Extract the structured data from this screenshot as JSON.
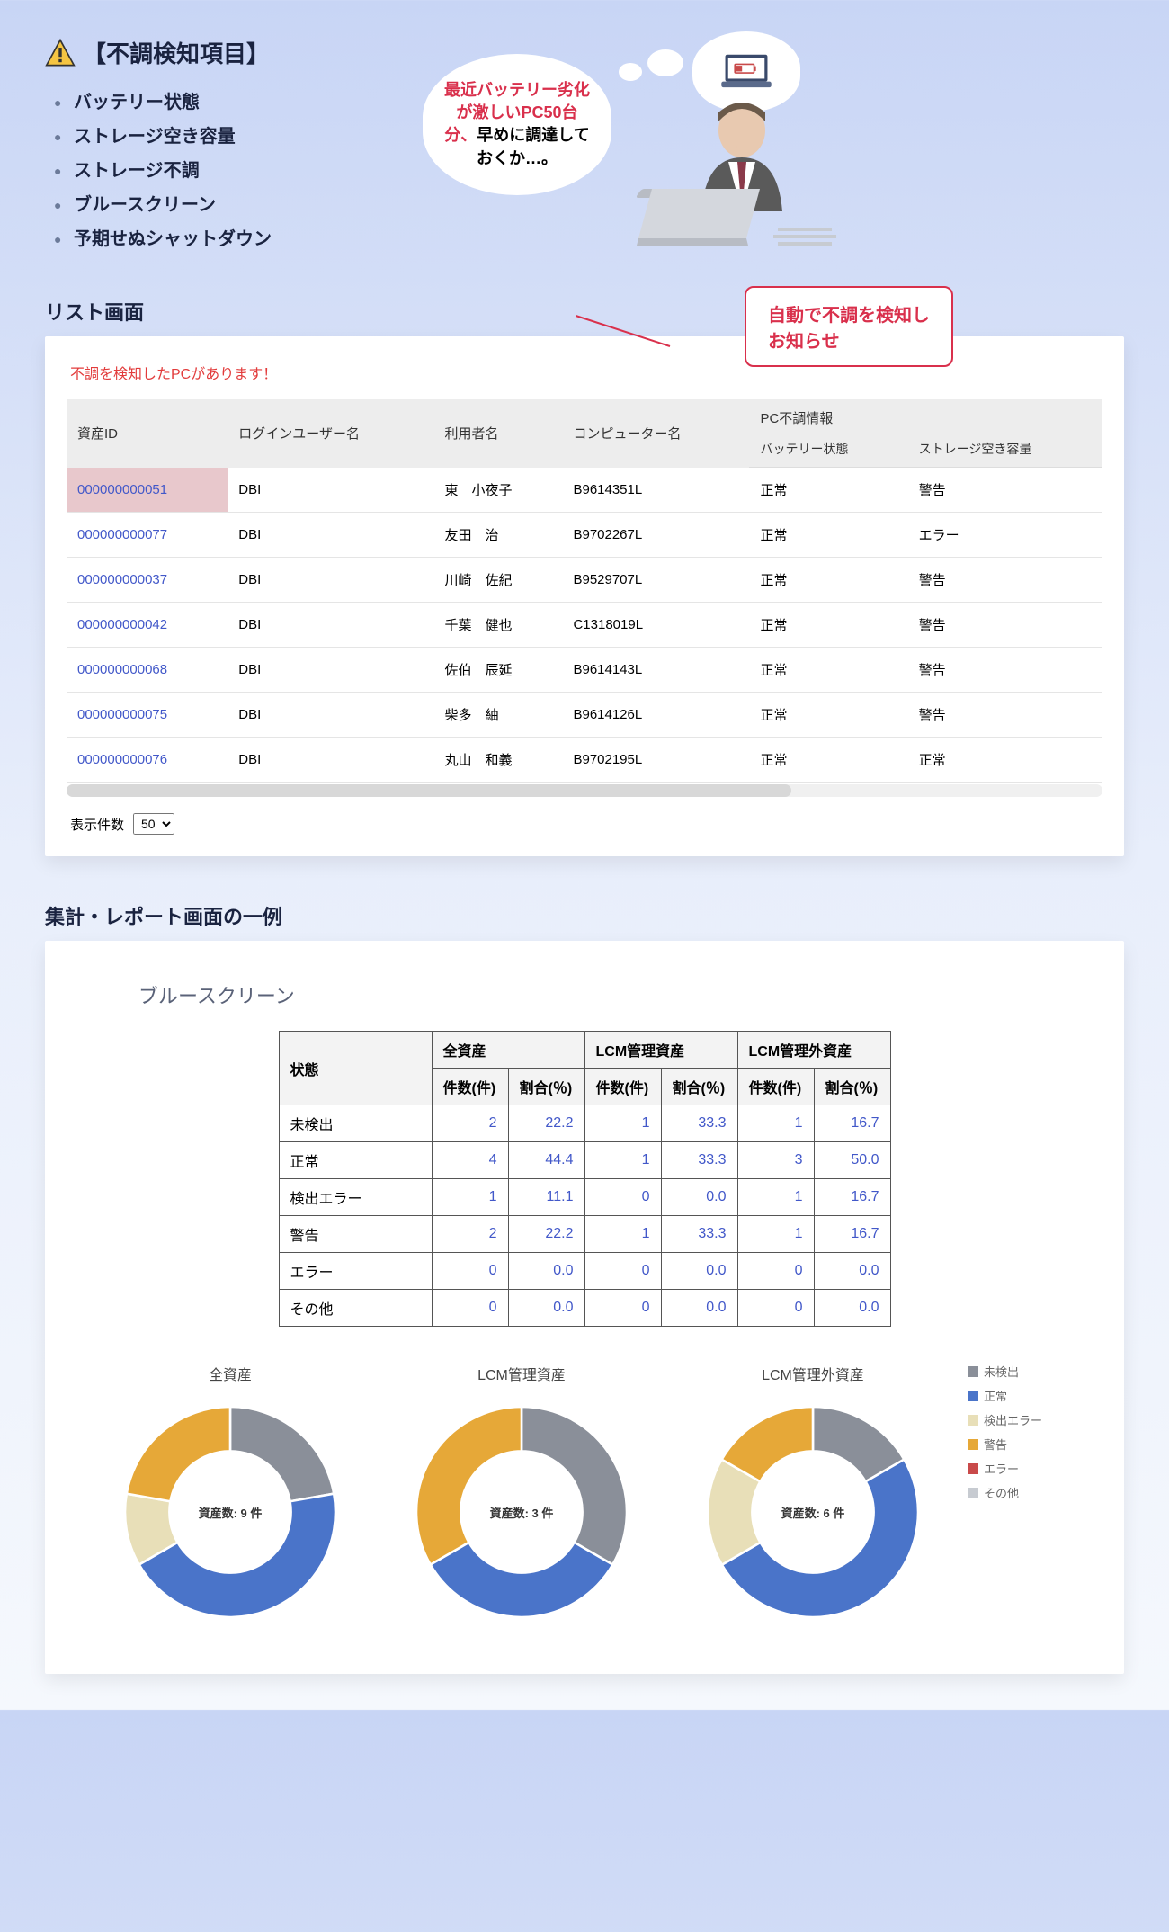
{
  "header": {
    "detection_title": "【不調検知項目】",
    "detection_items": [
      "バッテリー状態",
      "ストレージ空き容量",
      "ストレージ不調",
      "ブルースクリーン",
      "予期せぬシャットダウン"
    ],
    "thought_red": "最近バッテリー劣化が激しいPC50台分、",
    "thought_black": "早めに調達しておくか…。"
  },
  "list_section": {
    "label": "リスト画面",
    "callout": "自動で不調を検知し\nお知らせ",
    "alert": "不調を検知したPCがあります！",
    "columns": {
      "asset_id": "資産ID",
      "login_user": "ログインユーザー名",
      "user_name": "利用者名",
      "computer_name": "コンピューター名",
      "pc_fault_info": "PC不調情報",
      "battery": "バッテリー状態",
      "storage": "ストレージ空き容量"
    },
    "rows": [
      {
        "asset_id": "000000000051",
        "login": "DBI",
        "user": "東　小夜子",
        "computer": "B9614351L",
        "battery": "正常",
        "storage": "警告"
      },
      {
        "asset_id": "000000000077",
        "login": "DBI",
        "user": "友田　治",
        "computer": "B9702267L",
        "battery": "正常",
        "storage": "エラー"
      },
      {
        "asset_id": "000000000037",
        "login": "DBI",
        "user": "川崎　佐紀",
        "computer": "B9529707L",
        "battery": "正常",
        "storage": "警告"
      },
      {
        "asset_id": "000000000042",
        "login": "DBI",
        "user": "千葉　健也",
        "computer": "C1318019L",
        "battery": "正常",
        "storage": "警告"
      },
      {
        "asset_id": "000000000068",
        "login": "DBI",
        "user": "佐伯　辰延",
        "computer": "B9614143L",
        "battery": "正常",
        "storage": "警告"
      },
      {
        "asset_id": "000000000075",
        "login": "DBI",
        "user": "柴多　紬",
        "computer": "B9614126L",
        "battery": "正常",
        "storage": "警告"
      },
      {
        "asset_id": "000000000076",
        "login": "DBI",
        "user": "丸山　和義",
        "computer": "B9702195L",
        "battery": "正常",
        "storage": "正常"
      }
    ],
    "pager_label": "表示件数",
    "pager_value": "50"
  },
  "report_section": {
    "label": "集計・レポート画面の一例",
    "title": "ブルースクリーン",
    "table": {
      "head_state": "状態",
      "groups": [
        "全資産",
        "LCM管理資産",
        "LCM管理外資産"
      ],
      "sub_count": "件数(件)",
      "sub_pct": "割合(％)",
      "rows": [
        {
          "label": "未検出",
          "v": [
            2,
            22.2,
            1,
            33.3,
            1,
            16.7
          ]
        },
        {
          "label": "正常",
          "v": [
            4,
            44.4,
            1,
            33.3,
            3,
            50.0
          ]
        },
        {
          "label": "検出エラー",
          "v": [
            1,
            11.1,
            0,
            0.0,
            1,
            16.7
          ]
        },
        {
          "label": "警告",
          "v": [
            2,
            22.2,
            1,
            33.3,
            1,
            16.7
          ]
        },
        {
          "label": "エラー",
          "v": [
            0,
            0.0,
            0,
            0.0,
            0,
            0.0
          ]
        },
        {
          "label": "その他",
          "v": [
            0,
            0.0,
            0,
            0.0,
            0,
            0.0
          ]
        }
      ]
    },
    "legend": [
      "未検出",
      "正常",
      "検出エラー",
      "警告",
      "エラー",
      "その他"
    ],
    "legend_colors": [
      "#8a8f99",
      "#4a74c9",
      "#e8dfb8",
      "#e6a838",
      "#c94a4a",
      "#c7cbd1"
    ],
    "charts": [
      {
        "title": "全資産",
        "center": "資産数: 9 件",
        "slices": [
          22.2,
          44.4,
          11.1,
          22.2,
          0,
          0
        ]
      },
      {
        "title": "LCM管理資産",
        "center": "資産数: 3 件",
        "slices": [
          33.3,
          33.3,
          0,
          33.3,
          0,
          0
        ]
      },
      {
        "title": "LCM管理外資産",
        "center": "資産数: 6 件",
        "slices": [
          16.7,
          50.0,
          16.7,
          16.7,
          0,
          0
        ]
      }
    ]
  },
  "chart_data": [
    {
      "type": "pie",
      "title": "全資産",
      "categories": [
        "未検出",
        "正常",
        "検出エラー",
        "警告",
        "エラー",
        "その他"
      ],
      "values": [
        2,
        4,
        1,
        2,
        0,
        0
      ],
      "center_label": "資産数: 9 件"
    },
    {
      "type": "pie",
      "title": "LCM管理資産",
      "categories": [
        "未検出",
        "正常",
        "検出エラー",
        "警告",
        "エラー",
        "その他"
      ],
      "values": [
        1,
        1,
        0,
        1,
        0,
        0
      ],
      "center_label": "資産数: 3 件"
    },
    {
      "type": "pie",
      "title": "LCM管理外資産",
      "categories": [
        "未検出",
        "正常",
        "検出エラー",
        "警告",
        "エラー",
        "その他"
      ],
      "values": [
        1,
        3,
        1,
        1,
        0,
        0
      ],
      "center_label": "資産数: 6 件"
    }
  ]
}
